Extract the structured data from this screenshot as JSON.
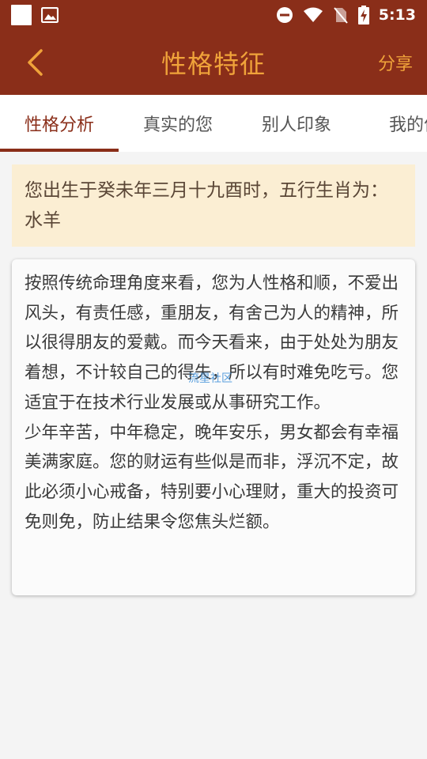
{
  "status_bar": {
    "time": "5:13",
    "icons": [
      "square-icon",
      "image-icon",
      "dnd-icon",
      "wifi-icon",
      "no-sim-icon",
      "battery-charging-icon"
    ]
  },
  "app_bar": {
    "back_icon": "chevron-left-icon",
    "title": "性格特征",
    "share_label": "分享"
  },
  "tabs": [
    {
      "label": "性格分析",
      "active": true
    },
    {
      "label": "真实的您",
      "active": false
    },
    {
      "label": "别人印象",
      "active": false
    },
    {
      "label": "我的优",
      "active": false
    }
  ],
  "birth_info": "您出生于癸未年三月十九酉时，五行生肖为：水羊",
  "analysis": {
    "paragraph1": "按照传统命理角度来看，您为人性格和顺，不爱出风头，有责任感，重朋友，有舍己为人的精神，所以很得朋友的爱戴。而今天看来，由于处处为朋友着想，不计较自己的得失，所以有时难免吃亏。您适宜于在技术行业发展或从事研究工作。",
    "paragraph2": "少年辛苦，中年稳定，晚年安乐，男女都会有幸福美满家庭。您的财运有些似是而非，浮沉不定，故此必须小心戒备，特别要小心理财，重大的投资可免则免，防止结果令您焦头烂额。"
  },
  "watermark": "流星社区",
  "colors": {
    "primary": "#8a2e19",
    "accent": "#f0a33a",
    "birth_box_bg": "#fbeed3"
  }
}
